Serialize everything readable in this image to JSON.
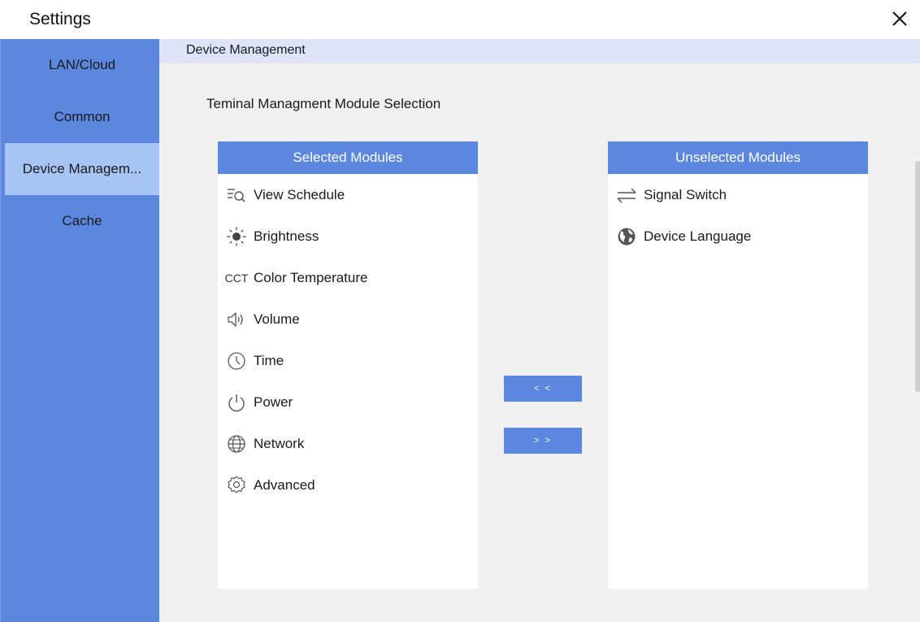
{
  "window": {
    "title": "Settings",
    "close_icon": "close-icon"
  },
  "colors": {
    "accent": "#5b87df",
    "active_item": "#a8c4f4",
    "header_band": "#dfe3f7",
    "background": "#f0f0f0"
  },
  "sidebar": {
    "items": [
      {
        "label": "LAN/Cloud",
        "active": false
      },
      {
        "label": "Common",
        "active": false
      },
      {
        "label": "Device Managem...",
        "active": true
      },
      {
        "label": "Cache",
        "active": false
      }
    ]
  },
  "main": {
    "section_title": "Device Management",
    "subtitle": "Teminal Managment Module Selection",
    "selected": {
      "header": "Selected Modules",
      "items": [
        {
          "label": "View Schedule",
          "icon": "schedule-search-icon"
        },
        {
          "label": "Brightness",
          "icon": "sun-icon"
        },
        {
          "label": "Color Temperature",
          "icon": "cct-icon",
          "icon_text": "CCT"
        },
        {
          "label": "Volume",
          "icon": "speaker-icon"
        },
        {
          "label": "Time",
          "icon": "clock-icon"
        },
        {
          "label": "Power",
          "icon": "power-icon"
        },
        {
          "label": "Network",
          "icon": "globe-icon"
        },
        {
          "label": "Advanced",
          "icon": "gear-icon"
        }
      ]
    },
    "unselected": {
      "header": "Unselected Modules",
      "items": [
        {
          "label": "Signal Switch",
          "icon": "swap-arrows-icon"
        },
        {
          "label": "Device Language",
          "icon": "earth-icon"
        }
      ]
    },
    "buttons": {
      "move_left": "< <",
      "move_right": "> >"
    }
  }
}
